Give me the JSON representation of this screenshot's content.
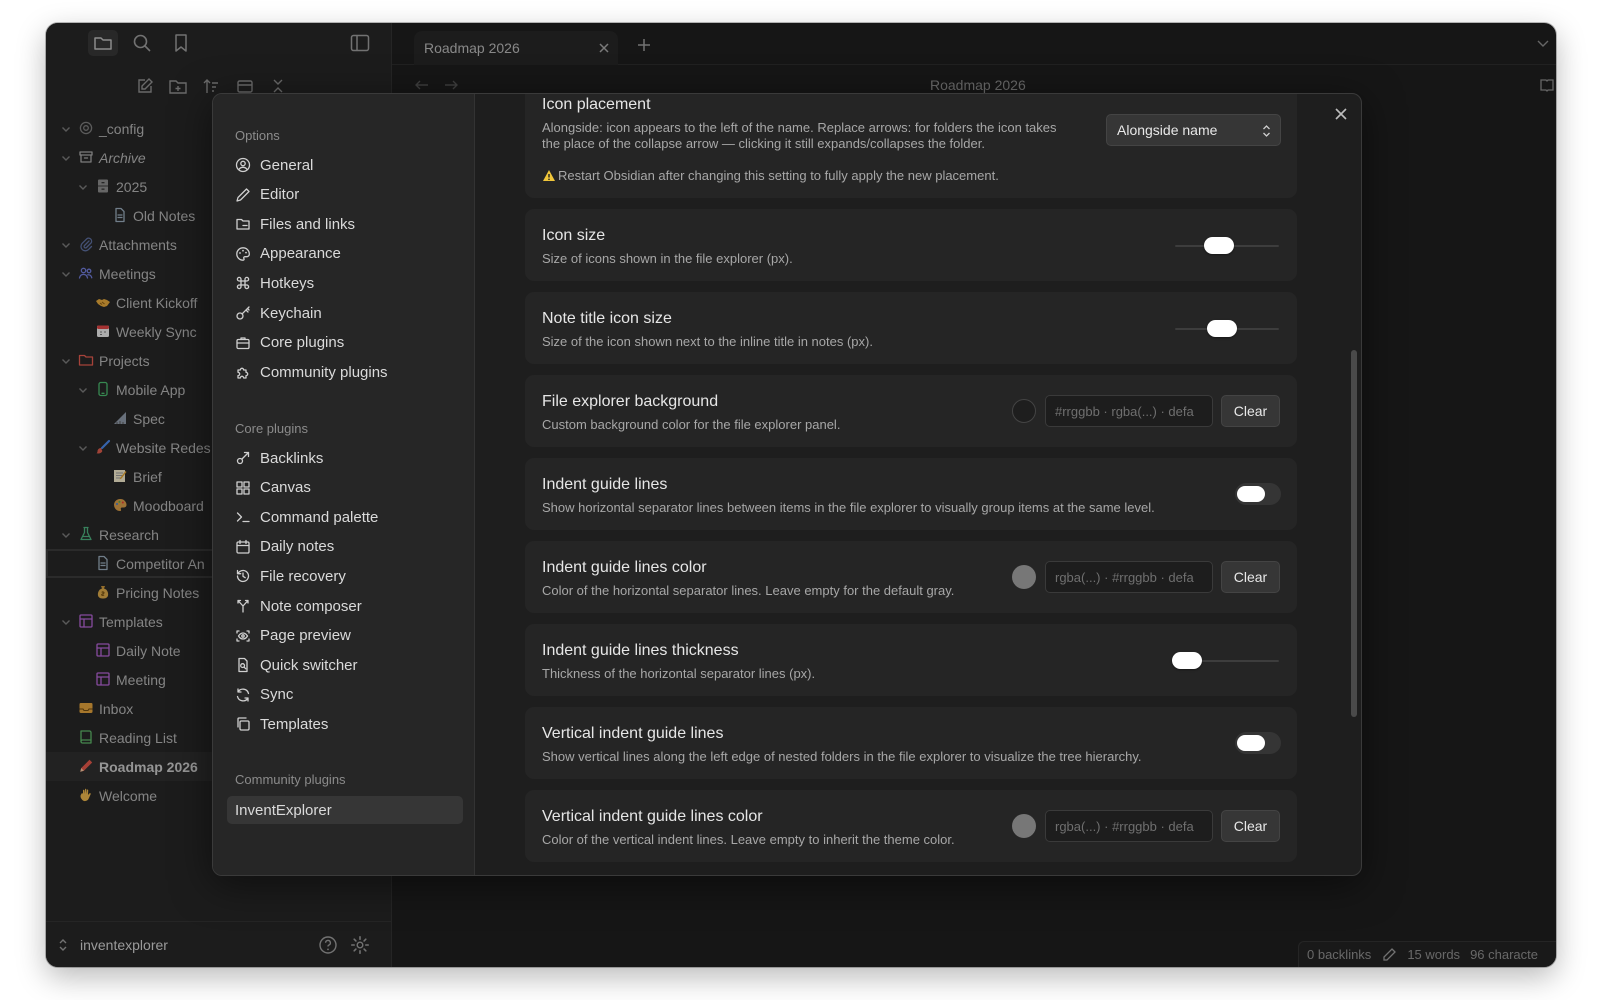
{
  "tab": {
    "title": "Roadmap 2026"
  },
  "document": {
    "title": "Roadmap 2026"
  },
  "file_tree": [
    {
      "label": "_config",
      "icon": "gear-icon",
      "depth": 0,
      "chevron": true
    },
    {
      "label": "Archive",
      "icon": "archive-icon",
      "depth": 0,
      "chevron": true,
      "italic": true
    },
    {
      "label": "2025",
      "icon": "cabinet-icon",
      "depth": 1,
      "chevron": true
    },
    {
      "label": "Old Notes",
      "icon": "file-icon",
      "depth": 2,
      "chevron": false
    },
    {
      "label": "Attachments",
      "icon": "paperclip-icon",
      "depth": 0,
      "chevron": true
    },
    {
      "label": "Meetings",
      "icon": "people-icon",
      "depth": 0,
      "chevron": true
    },
    {
      "label": "Client Kickoff",
      "icon": "handshake-icon",
      "depth": 1,
      "chevron": false
    },
    {
      "label": "Weekly Sync",
      "icon": "calendar-icon",
      "depth": 1,
      "chevron": false
    },
    {
      "label": "Projects",
      "icon": "folder-icon",
      "depth": 0,
      "chevron": true
    },
    {
      "label": "Mobile App",
      "icon": "phone-icon",
      "depth": 1,
      "chevron": true
    },
    {
      "label": "Spec",
      "icon": "ruler-icon",
      "depth": 2,
      "chevron": false
    },
    {
      "label": "Website Redes",
      "icon": "paintbrush-icon",
      "depth": 1,
      "chevron": true
    },
    {
      "label": "Brief",
      "icon": "memo-icon",
      "depth": 2,
      "chevron": false
    },
    {
      "label": "Moodboard",
      "icon": "palette-icon",
      "depth": 2,
      "chevron": false
    },
    {
      "label": "Research",
      "icon": "flask-icon",
      "depth": 0,
      "chevron": true
    },
    {
      "label": "Competitor An",
      "icon": "file-icon",
      "depth": 1,
      "chevron": false,
      "outlined": true
    },
    {
      "label": "Pricing Notes",
      "icon": "moneybag-icon",
      "depth": 1,
      "chevron": false
    },
    {
      "label": "Templates",
      "icon": "template-icon",
      "depth": 0,
      "chevron": true
    },
    {
      "label": "Daily Note",
      "icon": "template-icon",
      "depth": 1,
      "chevron": false
    },
    {
      "label": "Meeting",
      "icon": "template-icon",
      "depth": 1,
      "chevron": false
    },
    {
      "label": "Inbox",
      "icon": "inbox-icon",
      "depth": 0,
      "chevron": false
    },
    {
      "label": "Reading List",
      "icon": "book-icon",
      "depth": 0,
      "chevron": false
    },
    {
      "label": "Roadmap 2026",
      "icon": "pencil-icon",
      "depth": 0,
      "chevron": false,
      "selected": true,
      "bold": true
    },
    {
      "label": "Welcome",
      "icon": "wave-icon",
      "depth": 0,
      "chevron": false
    }
  ],
  "vault": {
    "name": "inventexplorer"
  },
  "status": {
    "backlinks": "0 backlinks",
    "words": "15 words",
    "chars": "96 characte"
  },
  "settings_nav": {
    "options_heading": "Options",
    "options": [
      {
        "label": "General",
        "icon": "user-circle-icon"
      },
      {
        "label": "Editor",
        "icon": "pencil-icon"
      },
      {
        "label": "Files and links",
        "icon": "folder-link-icon"
      },
      {
        "label": "Appearance",
        "icon": "palette-icon"
      },
      {
        "label": "Hotkeys",
        "icon": "command-icon"
      },
      {
        "label": "Keychain",
        "icon": "key-icon"
      },
      {
        "label": "Core plugins",
        "icon": "briefcase-icon"
      },
      {
        "label": "Community plugins",
        "icon": "puzzle-icon"
      }
    ],
    "core_heading": "Core plugins",
    "core": [
      {
        "label": "Backlinks",
        "icon": "backlinks-icon"
      },
      {
        "label": "Canvas",
        "icon": "grid-icon"
      },
      {
        "label": "Command palette",
        "icon": "terminal-icon"
      },
      {
        "label": "Daily notes",
        "icon": "calendar-icon"
      },
      {
        "label": "File recovery",
        "icon": "history-icon"
      },
      {
        "label": "Note composer",
        "icon": "merge-icon"
      },
      {
        "label": "Page preview",
        "icon": "eye-scan-icon"
      },
      {
        "label": "Quick switcher",
        "icon": "file-search-icon"
      },
      {
        "label": "Sync",
        "icon": "sync-icon"
      },
      {
        "label": "Templates",
        "icon": "copy-icon"
      }
    ],
    "community_heading": "Community plugins",
    "community": [
      {
        "label": "InventExplorer"
      }
    ]
  },
  "settings": {
    "icon_placement": {
      "title": "Icon placement",
      "desc1": "Alongside: icon appears to the left of the name. Replace arrows: for folders the icon takes",
      "desc2": "the place of the collapse arrow — clicking it still expands/collapses the folder.",
      "warning": "Restart Obsidian after changing this setting to fully apply the new placement.",
      "value": "Alongside name"
    },
    "icon_size": {
      "title": "Icon size",
      "desc": "Size of icons shown in the file explorer (px).",
      "level": 0.42
    },
    "note_title_icon_size": {
      "title": "Note title icon size",
      "desc": "Size of the icon shown next to the inline title in notes (px).",
      "level": 0.45
    },
    "explorer_bg": {
      "title": "File explorer background",
      "desc": "Custom background color for the file explorer panel.",
      "placeholder": "#rrggbb · rgba(...) · defa",
      "swatch": "#1e1e1e",
      "clear": "Clear"
    },
    "indent_lines": {
      "title": "Indent guide lines",
      "desc": "Show horizontal separator lines between items in the file explorer to visually group items at the same level.",
      "on": false
    },
    "indent_lines_color": {
      "title": "Indent guide lines color",
      "desc": "Color of the horizontal separator lines. Leave empty for the default gray.",
      "placeholder": "rgba(...) · #rrggbb · defa",
      "swatch": "#777777",
      "clear": "Clear"
    },
    "indent_thickness": {
      "title": "Indent guide lines thickness",
      "desc": "Thickness of the horizontal separator lines (px).",
      "level": 0.12
    },
    "vertical_lines": {
      "title": "Vertical indent guide lines",
      "desc": "Show vertical lines along the left edge of nested folders in the file explorer to visualize the tree hierarchy.",
      "on": false
    },
    "vertical_lines_color": {
      "title": "Vertical indent guide lines color",
      "desc": "Color of the vertical indent lines. Leave empty to inherit the theme color.",
      "placeholder": "rgba(...) · #rrggbb · defa",
      "swatch": "#777777",
      "clear": "Clear"
    }
  }
}
